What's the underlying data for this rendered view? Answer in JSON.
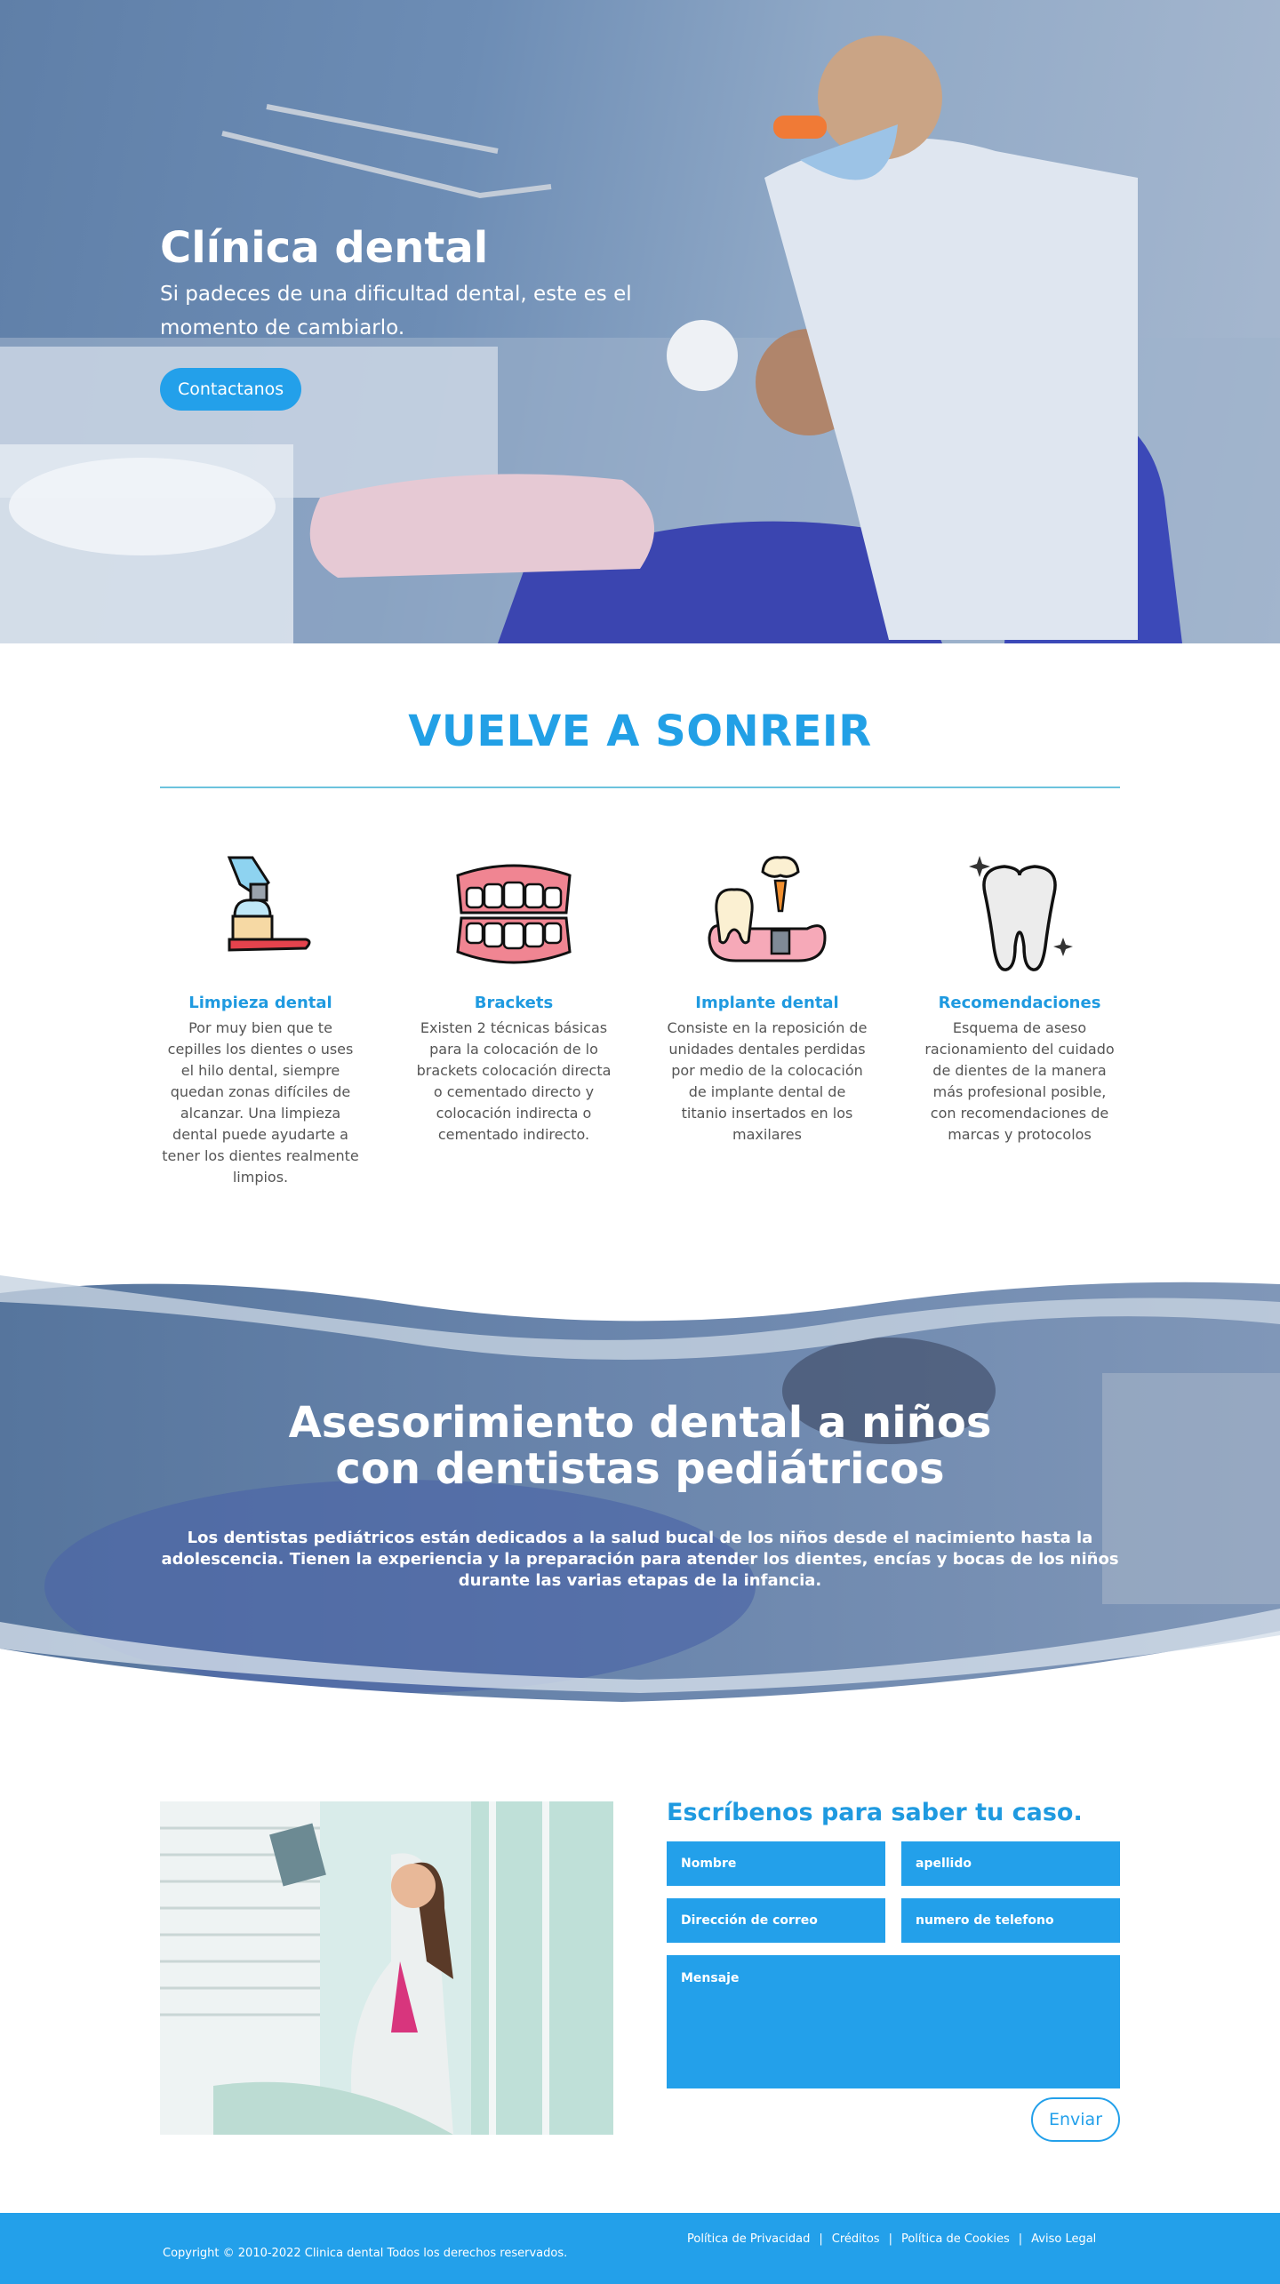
{
  "hero": {
    "title": "Clínica dental",
    "subtitle": "Si padeces de una dificultad dental, este es el momento de cambiarlo.",
    "button": "Contactanos"
  },
  "section": {
    "title": "VUELVE A SONREIR",
    "features": [
      {
        "icon": "toothbrush-toothpaste-icon",
        "title": "Limpieza dental",
        "text": "Por muy bien que te cepilles los dientes o uses el hilo dental, siempre quedan zonas difíciles de alcanzar. Una limpieza dental puede ayudarte a tener los dientes realmente limpios."
      },
      {
        "icon": "dentures-icon",
        "title": "Brackets",
        "text": "Existen 2 técnicas básicas para la colocación de lo brackets colocación directa o cementado directo y colocación indirecta o cementado indirecto."
      },
      {
        "icon": "dental-implant-icon",
        "title": "Implante dental",
        "text": "Consiste en la reposición de unidades dentales perdidas por medio de la colocación de implante dental de titanio insertados en los maxilares"
      },
      {
        "icon": "sparkling-tooth-icon",
        "title": "Recomendaciones",
        "text": "Esquema de aseso racionamiento del cuidado de dientes de la manera más profesional posible, con recomendaciones de marcas y protocolos"
      }
    ]
  },
  "kids": {
    "title": "Asesorimiento dental a niños con dentistas pediátricos",
    "text": "Los dentistas pediátricos están dedicados a la salud bucal de los niños desde el nacimiento hasta la adolescencia. Tienen la experiencia y la preparación para atender los dientes, encías y bocas de los niños durante las varias etapas de la infancia."
  },
  "contact": {
    "title": "Escríbenos para saber tu caso.",
    "nombre": "Nombre",
    "apellido": "apellido",
    "email": "Dirección de correo electrónico",
    "phone": "numero de telefono",
    "message": "Mensaje",
    "send": "Enviar"
  },
  "footer": {
    "copyright": "Copyright © 2010-2022 Clinica dental Todos los derechos reservados.",
    "links": [
      "Política de Privacidad",
      "Créditos",
      "Política de Cookies",
      "Aviso Legal"
    ]
  },
  "colors": {
    "accent": "#23a0ea",
    "title_blue": "#1f9ae0"
  }
}
